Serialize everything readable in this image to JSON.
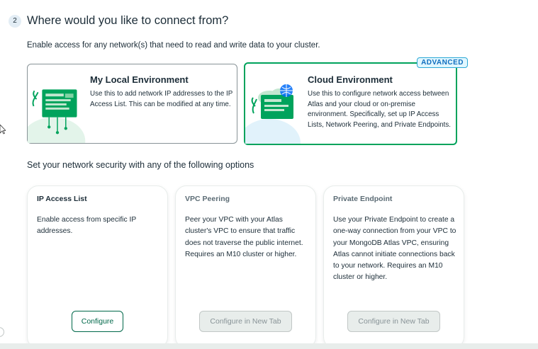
{
  "step": {
    "number": "2",
    "title": "Where would you like to connect from?",
    "description": "Enable access for any network(s) that need to read and write data to your cluster."
  },
  "environments": [
    {
      "title": "My Local Environment",
      "body": "Use this to add network IP addresses to the IP Access List. This can be modified at any time."
    },
    {
      "title": "Cloud Environment",
      "body": "Use this to configure network access between Atlas and your cloud or on-premise environment. Specifically, set up IP Access Lists, Network Peering, and Private Endpoints.",
      "badge": "ADVANCED"
    }
  ],
  "security": {
    "title": "Set your network security with any of the following options",
    "options": [
      {
        "title": "IP Access List",
        "body": "Enable access from specific IP addresses.",
        "button": "Configure"
      },
      {
        "title": "VPC Peering",
        "body": "Peer your VPC with your Atlas cluster's VPC to ensure that traffic does not traverse the public internet. Requires an M10 cluster or higher.",
        "button": "Configure in New Tab"
      },
      {
        "title": "Private Endpoint",
        "body": "Use your Private Endpoint to create a one-way connection from your VPC to your MongoDB Atlas VPC, ensuring Atlas cannot initiate connections back to your network. Requires an M10 cluster or higher.",
        "button": "Configure in New Tab"
      }
    ]
  },
  "colors": {
    "selected_border": "#00a35c",
    "primary_button": "#00684a",
    "illustration_green": "#00a35c",
    "badge_blue": "#0f6dbe"
  },
  "icons": {
    "local_illustration": "laptop-network-icon",
    "cloud_illustration": "cloud-globe-icon"
  }
}
